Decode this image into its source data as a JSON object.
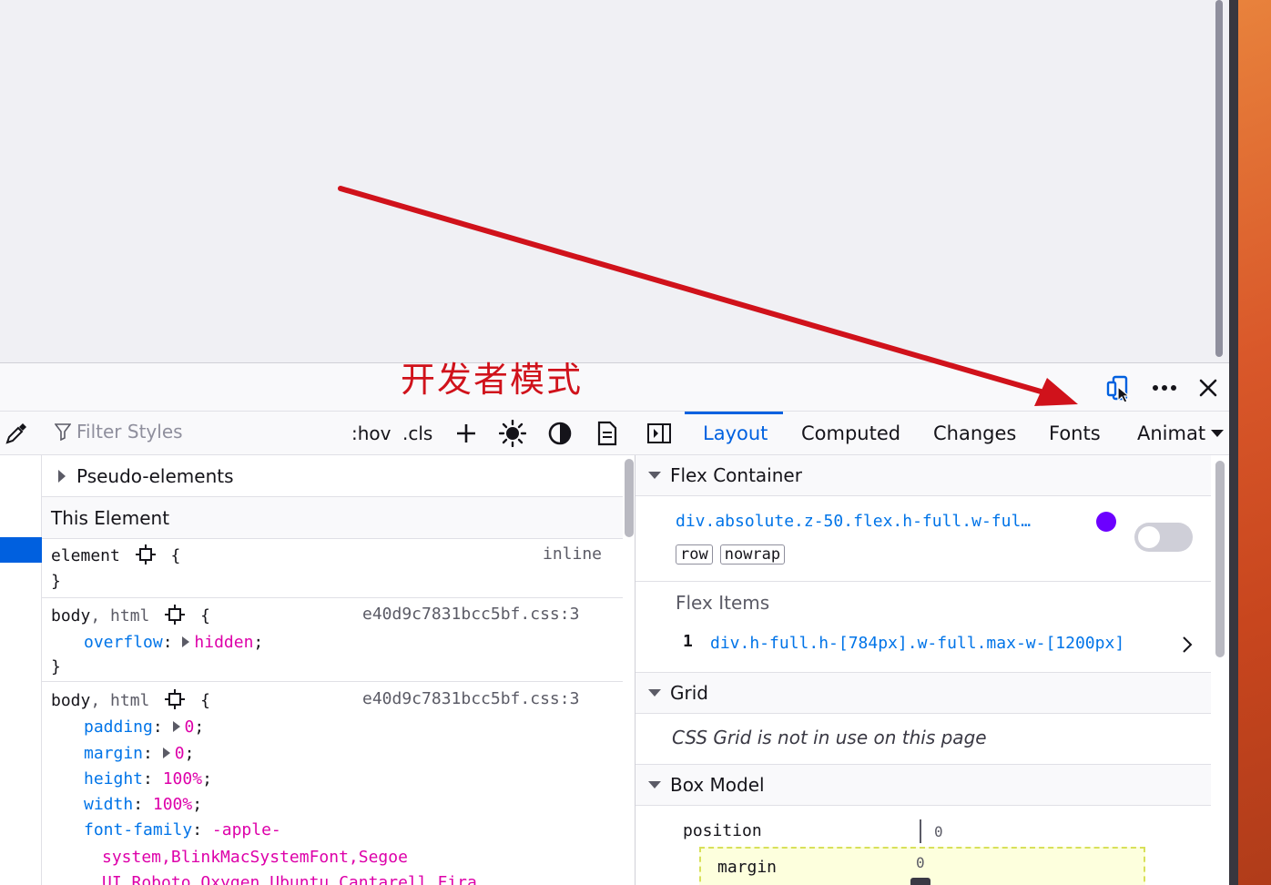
{
  "annotation": {
    "text": "开发者模式",
    "color": "#d0121b"
  },
  "toolbar": {
    "responsive_icon": "responsive-design-mode-icon",
    "more_icon": "more-options-icon",
    "close_icon": "close-icon"
  },
  "rules_toolbar": {
    "filter_placeholder": "Filter Styles",
    "hov_label": ":hov",
    "cls_label": ".cls",
    "add_icon": "plus-icon",
    "light_icon": "sun-icon",
    "dark_icon": "contrast-icon",
    "print_icon": "document-icon"
  },
  "rules": {
    "pseudo_elements": "Pseudo-elements",
    "this_element": "This Element",
    "rule1": {
      "selector": "element",
      "display": "inline",
      "close": "}"
    },
    "rule2": {
      "sel_a": "body",
      "sel_sep": ", ",
      "sel_b": "html",
      "source": "e40d9c7831bcc5bf.css:3",
      "prop": "overflow",
      "value": "hidden"
    },
    "rule3": {
      "sel_a": "body",
      "sel_sep": ", ",
      "sel_b": "html",
      "source": "e40d9c7831bcc5bf.css:3",
      "props": [
        {
          "name": "padding",
          "value": "0",
          "expand": true
        },
        {
          "name": "margin",
          "value": "0",
          "expand": true
        },
        {
          "name": "height",
          "value": "100%",
          "expand": false
        },
        {
          "name": "width",
          "value": "100%",
          "expand": false
        }
      ],
      "font_family_prop": "font-family",
      "font_family_line1": "-apple-",
      "font_family_line2": "system,BlinkMacSystemFont,Segoe",
      "font_family_line3": "UI,Roboto,Oxygen,Ubuntu,Cantarell,Fira"
    }
  },
  "side_tabs": {
    "layout": "Layout",
    "computed": "Computed",
    "changes": "Changes",
    "fonts": "Fonts",
    "animations": "Animat"
  },
  "layout": {
    "flex_container": {
      "header": "Flex Container",
      "selector": "div.absolute.z-50.flex.h-full.w-ful…",
      "dot_color": "#6c00ff",
      "tag_direction": "row",
      "tag_wrap": "nowrap",
      "items_label": "Flex Items",
      "item_index": "1",
      "item_selector": "div.h-full.h-[784px].w-full.max-w-[1200px]"
    },
    "grid": {
      "header": "Grid",
      "message": "CSS Grid is not in use on this page"
    },
    "box_model": {
      "header": "Box Model",
      "position_label": "position",
      "position_value": "0",
      "margin_label": "margin",
      "margin_value": "0"
    }
  }
}
